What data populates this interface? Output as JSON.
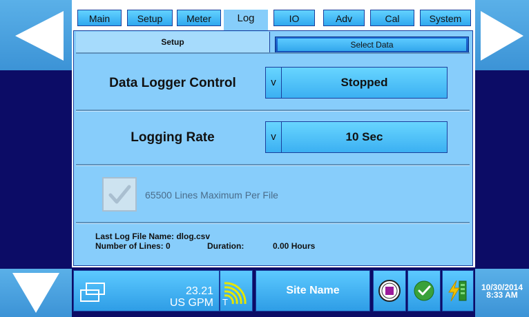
{
  "tabs": [
    {
      "label": "Main"
    },
    {
      "label": "Setup"
    },
    {
      "label": "Meter"
    },
    {
      "label": "Log"
    },
    {
      "label": "IO"
    },
    {
      "label": "Adv"
    },
    {
      "label": "Cal"
    },
    {
      "label": "System"
    }
  ],
  "active_tab": "Log",
  "subtabs": {
    "setup": "Setup",
    "select_data": "Select Data"
  },
  "logger": {
    "label": "Data Logger Control",
    "dropdown_marker": "v",
    "value": "Stopped"
  },
  "rate": {
    "label": "Logging Rate",
    "dropdown_marker": "v",
    "value": "10 Sec"
  },
  "checkbox": {
    "label": "65500 Lines Maximum Per File",
    "checked": true
  },
  "info": {
    "last_file": "Last Log File Name: dlog.csv",
    "lines_label": "Number of Lines: 0",
    "duration_label": "Duration:",
    "duration_value": "0.00 Hours"
  },
  "status": {
    "flow_value": "23.21",
    "flow_unit": "US GPM",
    "signal_marker": "T",
    "site_name": "Site Name",
    "date": "10/30/2014",
    "time": "8:33 AM"
  },
  "colors": {
    "accent": "#3bb0f2",
    "dark": "#0c0c66",
    "panel": "#87cdfb"
  }
}
